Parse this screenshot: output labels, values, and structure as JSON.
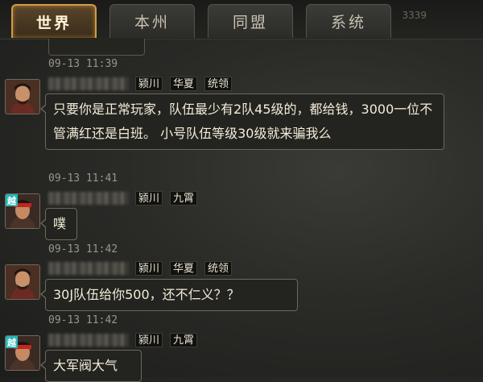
{
  "tabs": [
    {
      "label": "世界",
      "active": true
    },
    {
      "label": "本州",
      "active": false
    },
    {
      "label": "同盟",
      "active": false
    },
    {
      "label": "系统",
      "active": false
    }
  ],
  "header_counter": "3339",
  "messages": [
    {
      "timestamp": "09-13 11:39",
      "avatar": "warrior-portrait",
      "badge": "",
      "tags": [
        "颍川",
        "华夏",
        "统领"
      ],
      "text": "只要你是正常玩家，队伍最少有2队45级的，都给钱，3000一位不管满红还是白班。 小号队伍等级30级就来骗我么"
    },
    {
      "timestamp": "09-13 11:41",
      "avatar": "redband-portrait",
      "badge": "越",
      "tags": [
        "颍川",
        "九霄"
      ],
      "text": "噗"
    },
    {
      "timestamp": "09-13 11:42",
      "avatar": "warrior-portrait",
      "badge": "",
      "tags": [
        "颍川",
        "华夏",
        "统领"
      ],
      "text": "30J队伍给你500，还不仁义？？"
    },
    {
      "timestamp": "09-13 11:42",
      "avatar": "redband-portrait",
      "badge": "越",
      "tags": [
        "颍川",
        "九霄"
      ],
      "text": "大军阀大气"
    }
  ],
  "colors": {
    "active_tab_border": "#d19b45",
    "badge_bg": "#27b4b5",
    "bubble_border": "#6b685e"
  }
}
